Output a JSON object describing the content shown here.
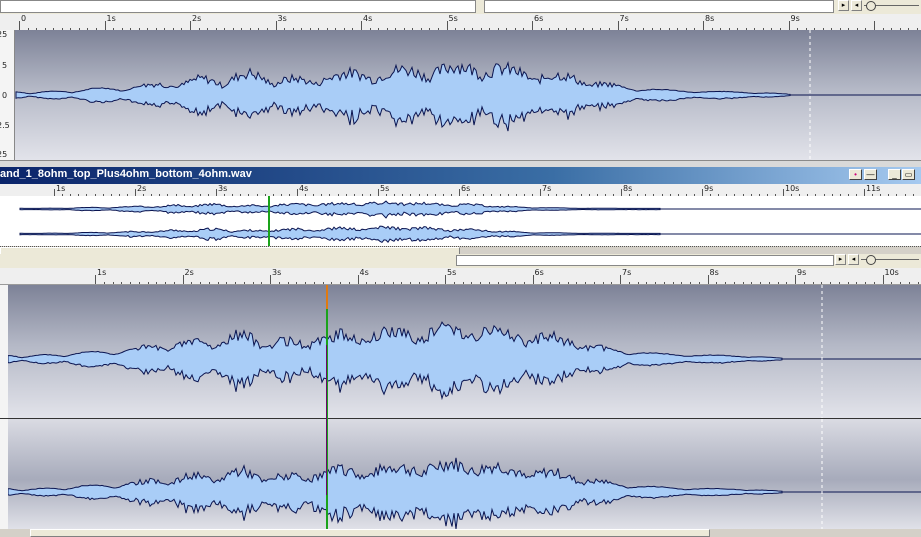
{
  "window_title": "and_1_8ohm_top_Plus4ohm_bottom_4ohm.wav",
  "ruler_main": [
    "0",
    "1s",
    "2s",
    "3s",
    "4s",
    "5s",
    "6s",
    "7s",
    "8s",
    "9s"
  ],
  "ruler_overview": [
    "1s",
    "2s",
    "3s",
    "4s",
    "5s",
    "6s",
    "7s",
    "8s",
    "9s",
    "10s",
    "11s"
  ],
  "ruler_lower": [
    "1s",
    "2s",
    "3s",
    "4s",
    "5s",
    "6s",
    "7s",
    "8s",
    "9s",
    "10s"
  ],
  "amplitude_labels": [
    "25",
    "5",
    "0",
    "2.5",
    "25"
  ],
  "colors": {
    "waveform_fill": "#a9cdf7",
    "waveform_stroke": "#0a1450",
    "cursor_green": "#1aa31a",
    "cursor_orange": "#e07a10",
    "cursor_purple": "#6a0a6a",
    "title_start": "#0a246a"
  },
  "icons": {
    "scroll_left": "◂",
    "scroll_right": "▸",
    "minimize": "_",
    "restore": "▭",
    "dash": "—",
    "marker": "•"
  }
}
